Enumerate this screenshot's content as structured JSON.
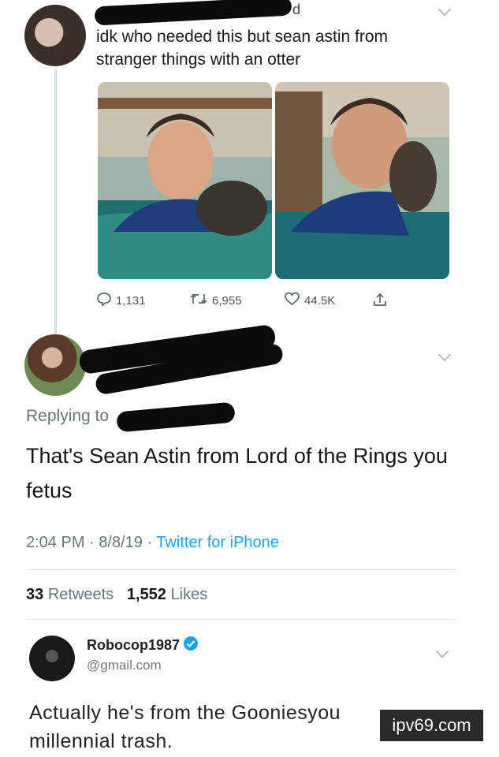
{
  "tweet1": {
    "name_suffix": "d",
    "text_line1": "idk who needed this but sean astin from",
    "text_line2": "stranger things with an otter",
    "replies": "1,131",
    "retweets": "6,955",
    "likes": "44.5K",
    "icons": [
      "reply-icon",
      "retweet-icon",
      "like-icon",
      "share-icon",
      "chevron-down-icon"
    ]
  },
  "tweet2": {
    "replying_to": "Replying to",
    "text": "That's Sean Astin from Lord of the Rings you fetus",
    "time": "2:04 PM",
    "date": "8/8/19",
    "source": "Twitter for iPhone",
    "retweets_count": "33",
    "retweets_label": "Retweets",
    "likes_count": "1,552",
    "likes_label": "Likes"
  },
  "tweet3": {
    "name": "Robocop1987",
    "handle": "@gmail.com",
    "text": "Actually he's from the Gooniesyou millennial trash.",
    "icons": [
      "verified-badge-icon",
      "chevron-down-icon"
    ]
  },
  "watermark": "ipv69.com",
  "colors": {
    "link": "#1da1f2",
    "muted": "#66757f",
    "verified": "#1da1f2"
  }
}
